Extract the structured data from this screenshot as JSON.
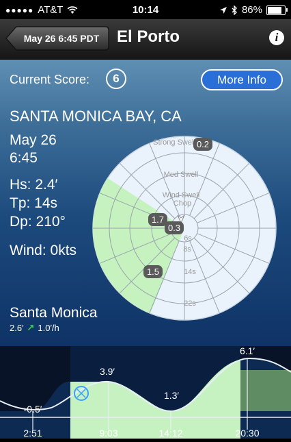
{
  "status_bar": {
    "carrier": "AT&T",
    "time": "10:14",
    "battery": "86%"
  },
  "nav": {
    "back_label": "May 26 6:45 PDT",
    "title": "El Porto",
    "info_label": "i"
  },
  "score": {
    "label": "Current Score:",
    "value": "6"
  },
  "more_info_label": "More Info",
  "location": "SANTA MONICA BAY, CA",
  "date": "May 26",
  "time": "6:45",
  "hs": "Hs: 2.4′",
  "tp": "Tp: 14s",
  "dp": "Dp: 210°",
  "wind": "Wind: 0kts",
  "swell_rose": {
    "rings": [
      "Strong Swell",
      "Med Swell",
      "Wind Swell",
      "Chop",
      "6s",
      "8s",
      "14s",
      "22s"
    ],
    "badges": [
      {
        "value": "0.2"
      },
      {
        "value": "1.7"
      },
      {
        "value": "0.3"
      },
      {
        "value": "1.5"
      }
    ],
    "highlight_color": "#c8f2c0"
  },
  "tide": {
    "location": "Santa Monica",
    "current_height": "2.6′",
    "rate": "1.0′/h",
    "extremes": [
      "-0.5′",
      "3.9′",
      "1.3′",
      "6.1′"
    ],
    "times": [
      "2:51",
      "9:03",
      "14:12",
      "20:30"
    ]
  }
}
